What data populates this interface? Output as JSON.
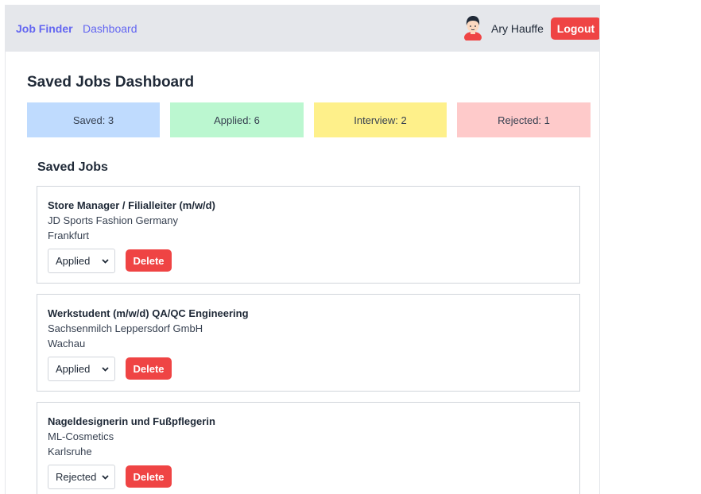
{
  "header": {
    "brand": "Job Finder",
    "nav_link": "Dashboard",
    "user_name": "Ary Hauffe",
    "logout_label": "Logout"
  },
  "page_title": "Saved Jobs Dashboard",
  "stats": {
    "saved": "Saved: 3",
    "applied": "Applied: 6",
    "interview": "Interview: 2",
    "rejected": "Rejected: 1"
  },
  "colors": {
    "accent": "#6366f1",
    "danger": "#ef4444",
    "saved": "#bfdbfe",
    "applied": "#bbf7d0",
    "interview": "#fef08a",
    "rejected": "#fecaca"
  },
  "section_title": "Saved Jobs",
  "jobs": [
    {
      "title": "Store Manager / Filialleiter (m/w/d)",
      "company": "JD Sports Fashion Germany",
      "location": "Frankfurt",
      "status": "Applied",
      "delete_label": "Delete"
    },
    {
      "title": "Werkstudent (m/w/d) QA/QC Engineering",
      "company": "Sachsenmilch Leppersdorf GmbH",
      "location": "Wachau",
      "status": "Applied",
      "delete_label": "Delete"
    },
    {
      "title": "Nageldesignerin und Fußpflegerin",
      "company": "ML-Cosmetics",
      "location": "Karlsruhe",
      "status": "Rejected",
      "delete_label": "Delete"
    }
  ]
}
